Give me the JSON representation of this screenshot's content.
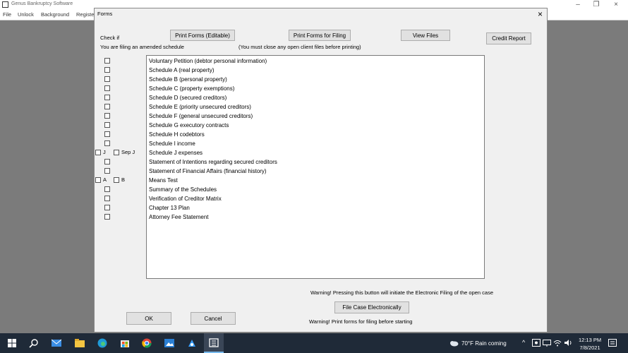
{
  "app": {
    "title": "Genus Bankruptcy Software",
    "menu": [
      "File",
      "Unlock",
      "Background",
      "Registe"
    ],
    "minimize": "–",
    "restore": "❐",
    "close": "×"
  },
  "dialog": {
    "title": "Forms",
    "close": "×",
    "check_if": "Check if",
    "amended_note": "You are filing an amended schedule",
    "print_editable": "Print Forms (Editable)",
    "print_filing": "Print Forms for Filing",
    "view_files": "View Files",
    "credit_report": "Credit Report",
    "close_note": "(You must close any open client files before printing)",
    "j_label": "J",
    "sepj_label": "Sep J",
    "a_label": "A",
    "b_label": "B",
    "forms": [
      "Voluntary Petition (debtor personal information)",
      "Schedule A (real property)",
      "Schedule B (personal property)",
      "Schedule C (property exemptions)",
      "Schedule D (secured creditors)",
      "Schedule E (priority unsecured creditors)",
      "Schedule F (general unsecured creditors)",
      "Schedule G executory contracts",
      "Schedule H codebtors",
      "Schedule I income",
      "Schedule J expenses",
      "Statement of Intentions regarding secured creditors",
      "Statement of Financial Affairs (financial history)",
      "Means Test",
      "Summary of the Schedules",
      "Verification of Creditor Matrix",
      "Chapter 13 Plan",
      "Attorney Fee Statement"
    ],
    "warning_electronic": "Warning! Pressing this button will initiate the Electronic Filing of the open case",
    "file_electronic": "File Case Electronically",
    "warning_print": "Warning! Print forms for filing before starting",
    "ok": "OK",
    "cancel": "Cancel"
  },
  "taskbar": {
    "weather": "70°F  Rain coming",
    "time": "12:13 PM",
    "date": "7/8/2021"
  },
  "colors": {
    "taskbar": "#1f2a38",
    "dialog_bg": "#f0f0f0",
    "button_bg": "#e1e1e1"
  }
}
